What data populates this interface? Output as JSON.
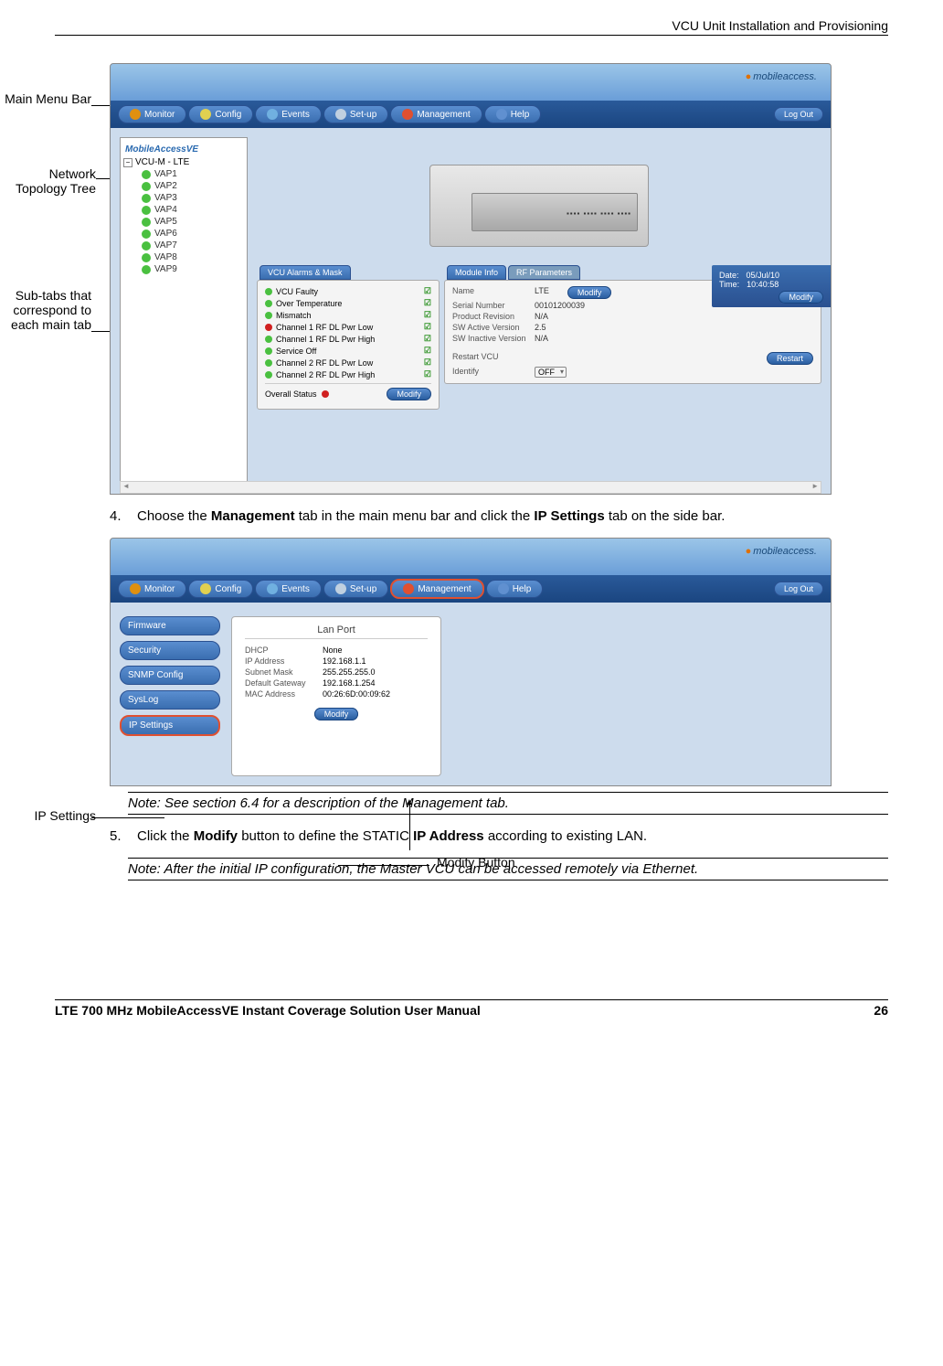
{
  "header": "VCU Unit Installation and Provisioning",
  "callouts": {
    "main_menu": "Main Menu Bar",
    "topology": "Network Topology Tree",
    "subtabs": "Sub-tabs that correspond to each main tab",
    "ip": "IP Settings",
    "modify": "Modify Button"
  },
  "ss1": {
    "logo": "mobileaccess."
  },
  "menu": {
    "monitor": "Monitor",
    "config": "Config",
    "events": "Events",
    "setup": "Set-up",
    "management": "Management",
    "help": "Help",
    "logout": "Log Out"
  },
  "tree": {
    "header": "MobileAccessVE",
    "root": "VCU-M - LTE",
    "vaps": [
      "VAP1",
      "VAP2",
      "VAP3",
      "VAP4",
      "VAP5",
      "VAP6",
      "VAP7",
      "VAP8",
      "VAP9"
    ]
  },
  "alarms": {
    "tab": "VCU Alarms & Mask",
    "items": [
      "VCU Faulty",
      "Over Temperature",
      "Mismatch",
      "Channel 1 RF DL Pwr Low",
      "Channel 1 RF DL Pwr High",
      "Service Off",
      "Channel 2 RF DL Pwr Low",
      "Channel 2 RF DL Pwr High"
    ],
    "overall": "Overall Status"
  },
  "info": {
    "tab1": "Module Info",
    "tab2": "RF Parameters",
    "rows": [
      {
        "l": "Name",
        "v": "LTE"
      },
      {
        "l": "Serial Number",
        "v": "00101200039"
      },
      {
        "l": "Product Revision",
        "v": "N/A"
      },
      {
        "l": "SW Active Version",
        "v": "2.5"
      },
      {
        "l": "SW Inactive Version",
        "v": "N/A"
      }
    ],
    "restart": "Restart VCU",
    "identify": "Identify",
    "identify_val": "OFF"
  },
  "dt": {
    "date_l": "Date:",
    "date_v": "05/Jul/10",
    "time_l": "Time:",
    "time_v": "10:40:58"
  },
  "buttons": {
    "modify": "Modify",
    "restart": "Restart"
  },
  "side2": [
    "Firmware",
    "Security",
    "SNMP Config",
    "SysLog",
    "IP Settings"
  ],
  "lan": {
    "title": "Lan Port",
    "rows": [
      {
        "l": "DHCP",
        "v": "None"
      },
      {
        "l": "IP Address",
        "v": "192.168.1.1"
      },
      {
        "l": "Subnet Mask",
        "v": "255.255.255.0"
      },
      {
        "l": "Default Gateway",
        "v": "192.168.1.254"
      },
      {
        "l": "MAC Address",
        "v": "00:26:6D:00:09:62"
      }
    ]
  },
  "steps": {
    "s4": {
      "num": "4.",
      "t1": "Choose the",
      "b1": "Management",
      "t2": "tab in the main menu bar and click the",
      "b2": "IP Settings",
      "t3": "tab on the side bar."
    },
    "s5": {
      "num": "5.",
      "t1": "Click the",
      "b1": "Modify",
      "t2": "button to define the STATIC",
      "b2": "IP Address",
      "t3": "according to existing LAN."
    }
  },
  "notes": {
    "n1": "Note: See section 6.4 for a description of the Management tab.",
    "n2": "Note: After the initial IP configuration, the Master VCU can be accessed remotely via Ethernet."
  },
  "footer": {
    "title": "LTE 700 MHz MobileAccessVE Instant Coverage Solution User Manual",
    "page": "26"
  }
}
